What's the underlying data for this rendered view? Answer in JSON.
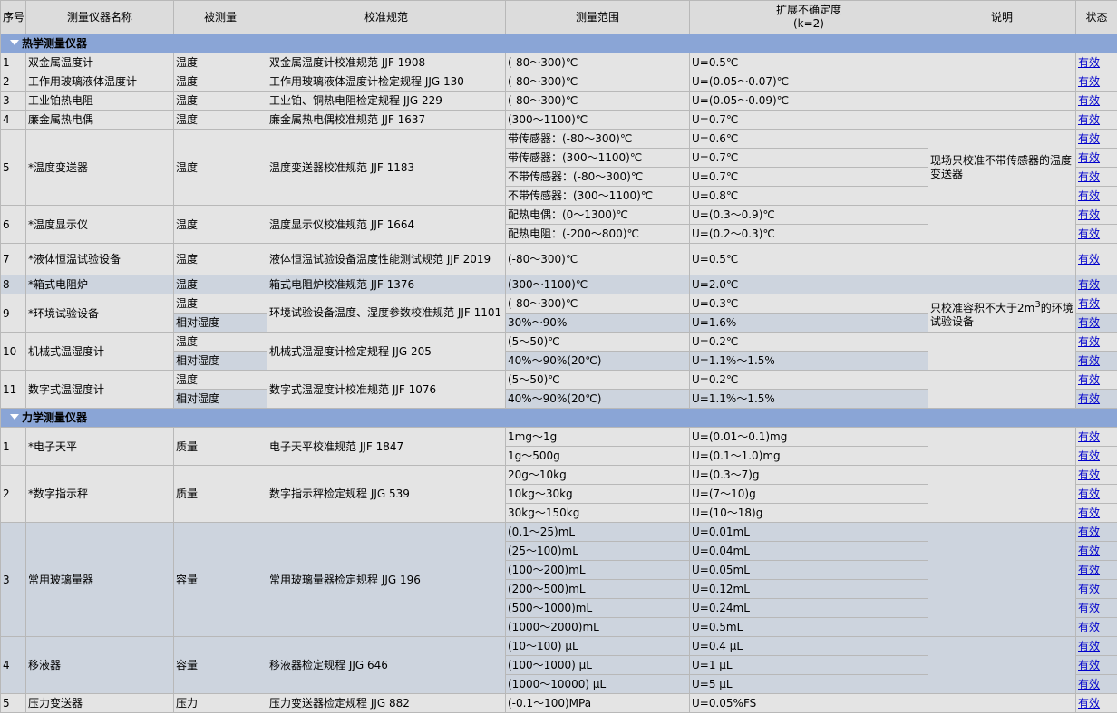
{
  "headers": {
    "no": "序号",
    "name": "测量仪器名称",
    "measurand": "被测量",
    "spec": "校准规范",
    "range": "测量范围",
    "uncert_line1": "扩展不确定度",
    "uncert_line2": "(k=2)",
    "note": "说明",
    "status": "状态"
  },
  "groups": {
    "thermal": "热学测量仪器",
    "mechanical": "力学测量仪器"
  },
  "status_label": "有效",
  "thermal": {
    "r1": {
      "no": "1",
      "name": "双金属温度计",
      "m": "温度",
      "spec": "双金属温度计校准规范 JJF 1908",
      "range": "(-80～300)℃",
      "u": "U=0.5℃"
    },
    "r2": {
      "no": "2",
      "name": "工作用玻璃液体温度计",
      "m": "温度",
      "spec": "工作用玻璃液体温度计检定规程 JJG 130",
      "range": "(-80～300)℃",
      "u": "U=(0.05～0.07)℃"
    },
    "r3": {
      "no": "3",
      "name": "工业铂热电阻",
      "m": "温度",
      "spec": "工业铂、铜热电阻检定规程 JJG 229",
      "range": "(-80～300)℃",
      "u": "U=(0.05～0.09)℃"
    },
    "r4": {
      "no": "4",
      "name": "廉金属热电偶",
      "m": "温度",
      "spec": "廉金属热电偶校准规范 JJF 1637",
      "range": "(300～1100)℃",
      "u": "U=0.7℃"
    },
    "r5": {
      "no": "5",
      "name": "*温度变送器",
      "m": "温度",
      "spec": "温度变送器校准规范 JJF 1183",
      "ranges": [
        "带传感器：(-80～300)℃",
        "带传感器：(300～1100)℃",
        "不带传感器：(-80～300)℃",
        "不带传感器：(300～1100)℃"
      ],
      "us": [
        "U=0.6℃",
        "U=0.7℃",
        "U=0.7℃",
        "U=0.8℃"
      ],
      "note": "现场只校准不带传感器的温度变送器"
    },
    "r6": {
      "no": "6",
      "name": "*温度显示仪",
      "m": "温度",
      "spec": "温度显示仪校准规范 JJF 1664",
      "ranges": [
        "配热电偶：(0～1300)℃",
        "配热电阻：(-200～800)℃"
      ],
      "us": [
        "U=(0.3～0.9)℃",
        "U=(0.2～0.3)℃"
      ]
    },
    "r7": {
      "no": "7",
      "name": "*液体恒温试验设备",
      "m": "温度",
      "spec": "液体恒温试验设备温度性能测试规范 JJF 2019",
      "range": "(-80～300)℃",
      "u": "U=0.5℃"
    },
    "r8": {
      "no": "8",
      "name": "*箱式电阻炉",
      "m": "温度",
      "spec": "箱式电阻炉校准规范 JJF 1376",
      "range": "(300～1100)℃",
      "u": "U=2.0℃"
    },
    "r9": {
      "no": "9",
      "name": "*环境试验设备",
      "ms": [
        "温度",
        "相对湿度"
      ],
      "spec": "环境试验设备温度、湿度参数校准规范 JJF 1101",
      "ranges": [
        "(-80～300)℃",
        "30%～90%"
      ],
      "us": [
        "U=0.3℃",
        "U=1.6%"
      ],
      "note_pre": "只校准容积不大于2m",
      "note_sup": "3",
      "note_post": "的环境试验设备"
    },
    "r10": {
      "no": "10",
      "name": "机械式温湿度计",
      "ms": [
        "温度",
        "相对湿度"
      ],
      "spec": "机械式温湿度计检定规程 JJG 205",
      "ranges": [
        "(5～50)℃",
        "40%～90%(20℃)"
      ],
      "us": [
        "U=0.2℃",
        "U=1.1%～1.5%"
      ]
    },
    "r11": {
      "no": "11",
      "name": "数字式温湿度计",
      "ms": [
        "温度",
        "相对湿度"
      ],
      "spec": "数字式温湿度计校准规范 JJF 1076",
      "ranges": [
        "(5～50)℃",
        "40%～90%(20℃)"
      ],
      "us": [
        "U=0.2℃",
        "U=1.1%～1.5%"
      ]
    }
  },
  "mechanical": {
    "r1": {
      "no": "1",
      "name": "*电子天平",
      "m": "质量",
      "spec": "电子天平校准规范 JJF 1847",
      "ranges": [
        "1mg～1g",
        "1g～500g"
      ],
      "us": [
        "U=(0.01～0.1)mg",
        "U=(0.1～1.0)mg"
      ]
    },
    "r2": {
      "no": "2",
      "name": "*数字指示秤",
      "m": "质量",
      "spec": "数字指示秤检定规程 JJG 539",
      "ranges": [
        "20g～10kg",
        "10kg～30kg",
        "30kg～150kg"
      ],
      "us": [
        "U=(0.3～7)g",
        "U=(7～10)g",
        "U=(10～18)g"
      ]
    },
    "r3": {
      "no": "3",
      "name": "常用玻璃量器",
      "m": "容量",
      "spec": "常用玻璃量器检定规程 JJG 196",
      "ranges": [
        "(0.1～25)mL",
        "(25～100)mL",
        "(100～200)mL",
        "(200～500)mL",
        "(500～1000)mL",
        "(1000～2000)mL"
      ],
      "us": [
        "U=0.01mL",
        "U=0.04mL",
        "U=0.05mL",
        "U=0.12mL",
        "U=0.24mL",
        "U=0.5mL"
      ]
    },
    "r4": {
      "no": "4",
      "name": "移液器",
      "m": "容量",
      "spec": "移液器检定规程 JJG 646",
      "ranges": [
        "(10～100) μL",
        "(100～1000) μL",
        "(1000～10000) μL"
      ],
      "us": [
        "U=0.4 μL",
        "U=1 μL",
        "U=5 μL"
      ]
    },
    "r5": {
      "no": "5",
      "name": "压力变送器",
      "m": "压力",
      "spec": "压力变送器检定规程 JJG 882",
      "range": "(-0.1～100)MPa",
      "u": "U=0.05%FS"
    }
  }
}
